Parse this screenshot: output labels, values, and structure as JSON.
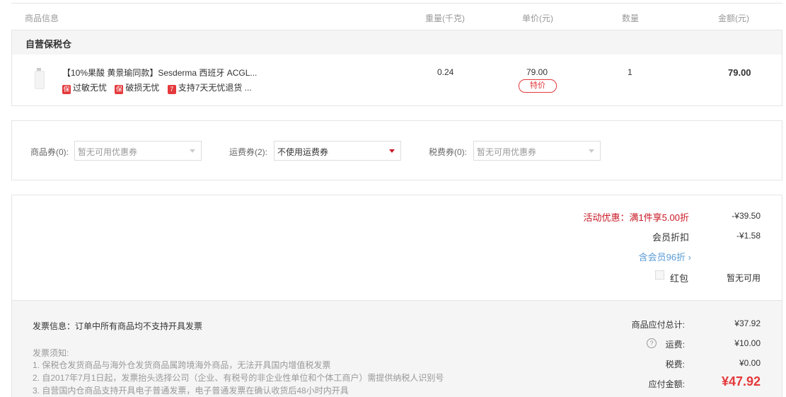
{
  "header": {
    "product_info": "商品信息",
    "weight": "重量(千克)",
    "unit_price": "单价(元)",
    "quantity": "数量",
    "amount": "金额(元)"
  },
  "warehouse": {
    "name": "自营保税仓"
  },
  "product": {
    "title": "【10%果酸 黄景瑜同款】Sesderma 西班牙 ACGL...",
    "weight": "0.24",
    "price": "79.00",
    "price_badge": "特价",
    "quantity": "1",
    "amount": "79.00",
    "services": [
      {
        "icon": "保",
        "label": "过敏无忧"
      },
      {
        "icon": "保",
        "label": "破损无忧"
      },
      {
        "icon": "7",
        "label": "支持7天无忧退货 ..."
      }
    ]
  },
  "coupons": {
    "goods": {
      "label": "商品券(0):",
      "value": "暂无可用优惠券"
    },
    "shipping": {
      "label": "运费券(2):",
      "value": "不使用运费券"
    },
    "tax": {
      "label": "税费券(0):",
      "value": "暂无可用优惠券"
    }
  },
  "discounts": {
    "activity_label": "活动优惠：满1件享5.00折",
    "activity_value": "-¥39.50",
    "member_label": "会员折扣",
    "member_value": "-¥1.58",
    "member_link": "含会员96折 ›",
    "red_packet_label": "红包",
    "red_packet_value": "暂无可用"
  },
  "invoice": {
    "info": "发票信息：订单中所有商品均不支持开具发票",
    "notice_title": "发票须知:",
    "notes": [
      "1. 保税仓发货商品与海外仓发货商品属跨境海外商品，无法开具国内增值税发票",
      "2. 自2017年7月1日起，发票抬头选择公司（企业、有税号的非企业性单位和个体工商户）需提供纳税人识别号",
      "3. 自营国内仓商品支持开具电子普通发票，电子普通发票在确认收货后48小时内开具"
    ]
  },
  "totals": {
    "goods_total_label": "商品应付总计:",
    "goods_total_value": "¥37.92",
    "shipping_label": "运费:",
    "shipping_value": "¥10.00",
    "tax_label": "税费:",
    "tax_value": "¥0.00",
    "payable_label": "应付金额:",
    "payable_value": "¥47.92"
  },
  "colors": {
    "accent_red": "#e4393c",
    "price_red": "#c81623",
    "link_blue": "#5a9bd5"
  }
}
